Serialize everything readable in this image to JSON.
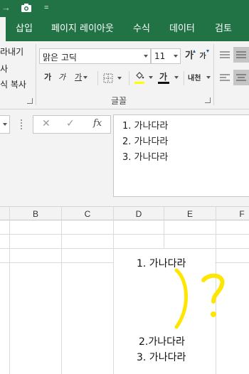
{
  "app": {
    "accent": "#217346",
    "ribbon_bg": "#f3f3f3",
    "annotation_color": "#ffe600"
  },
  "titlebar": {
    "qat_arrow": "→",
    "camera_icon": "camera-icon",
    "customize": "="
  },
  "tabs": [
    "삽입",
    "페이지 레이아웃",
    "수식",
    "데이터",
    "검토"
  ],
  "ribbon": {
    "clipboard": {
      "cut_fragment": "라내기",
      "copy_fragment": "사",
      "format_copy_fragment": "식 복사"
    },
    "font": {
      "font_name": "맑은 고딕",
      "font_size": "11",
      "grow_label": "가",
      "shrink_label": "가",
      "bold_label": "가",
      "italic_label": "가",
      "underline_label": "가",
      "font_color_label": "가",
      "phonetic_label": "내천",
      "group_label": "글꼴"
    }
  },
  "formula_bar": {
    "cancel_symbol": "✕",
    "enter_symbol": "✓",
    "fx_label": "fx",
    "lines": [
      "1. 가나다라",
      "2. 가나다라",
      "3. 가나다라"
    ]
  },
  "columns": [
    "B",
    "C",
    "D",
    "E",
    "F"
  ],
  "cell": {
    "line1": "1. 가나다라",
    "line2": "2.가나다라",
    "line3": "3. 가나다라"
  },
  "annotation": {
    "text": ")?"
  }
}
